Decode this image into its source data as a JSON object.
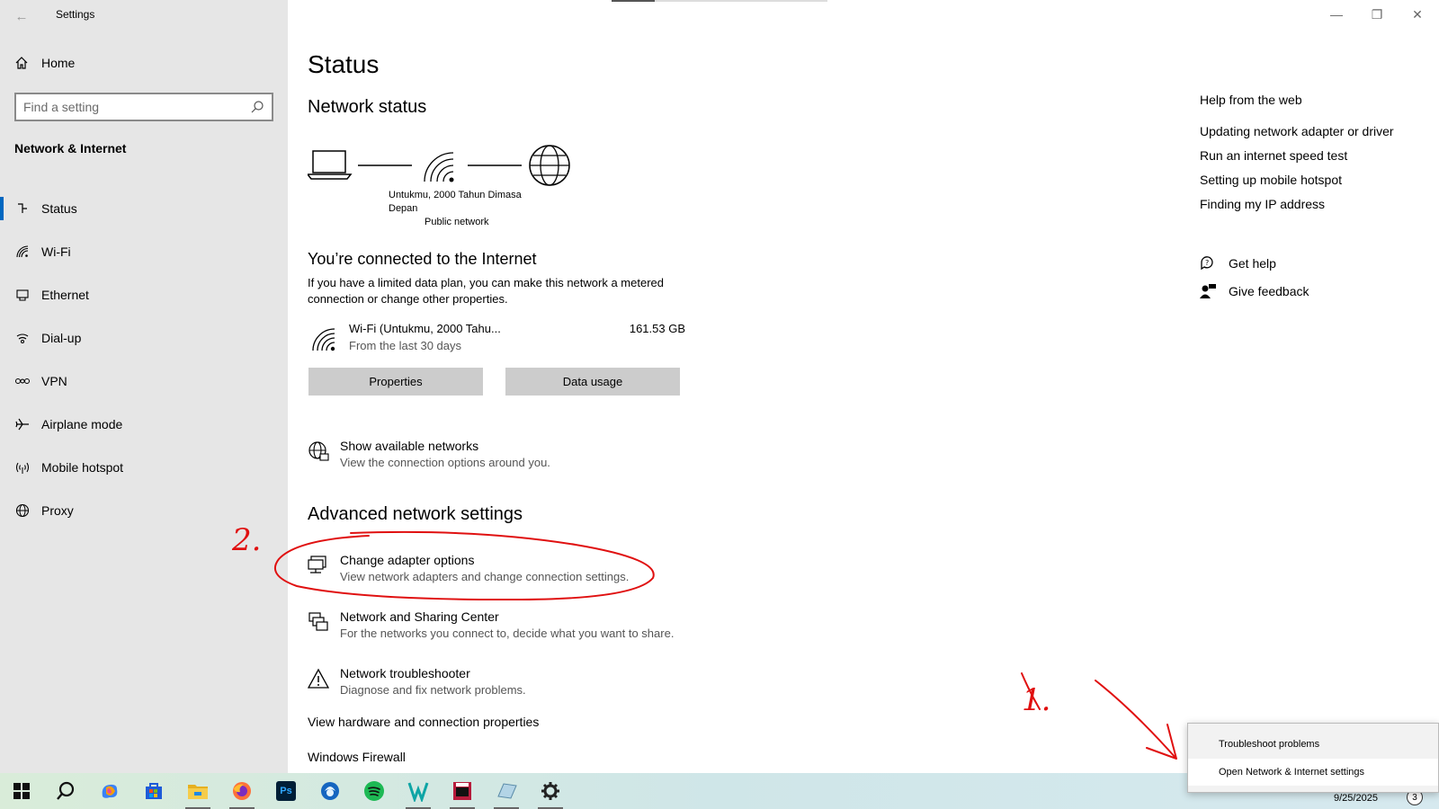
{
  "window": {
    "title": "Settings",
    "minimize_glyph": "—",
    "maximize_glyph": "❐",
    "close_glyph": "✕",
    "back_glyph": "←"
  },
  "sidebar": {
    "home_label": "Home",
    "search_placeholder": "Find a setting",
    "section_title": "Network & Internet",
    "items": [
      {
        "label": "Status",
        "icon": "status-icon",
        "active": true
      },
      {
        "label": "Wi-Fi",
        "icon": "wifi-icon"
      },
      {
        "label": "Ethernet",
        "icon": "ethernet-icon"
      },
      {
        "label": "Dial-up",
        "icon": "dialup-icon"
      },
      {
        "label": "VPN",
        "icon": "vpn-icon"
      },
      {
        "label": "Airplane mode",
        "icon": "airplane-icon"
      },
      {
        "label": "Mobile hotspot",
        "icon": "hotspot-icon"
      },
      {
        "label": "Proxy",
        "icon": "globe-icon"
      }
    ]
  },
  "main": {
    "title": "Status",
    "network_status_heading": "Network status",
    "diagram": {
      "network_name": "Untukmu, 2000 Tahun Dimasa Depan",
      "network_type": "Public network"
    },
    "connected": {
      "title": "You’re connected to the Internet",
      "description": "If you have a limited data plan, you can make this network a metered connection or change other properties."
    },
    "wifi_row": {
      "name": "Wi-Fi (Untukmu, 2000 Tahu...",
      "subtitle": "From the last 30 days",
      "usage": "161.53 GB"
    },
    "buttons": {
      "properties": "Properties",
      "data_usage": "Data usage"
    },
    "show_networks": {
      "title": "Show available networks",
      "description": "View the connection options around you."
    },
    "advanced_heading": "Advanced network settings",
    "advanced_items": [
      {
        "title": "Change adapter options",
        "description": "View network adapters and change connection settings."
      },
      {
        "title": "Network and Sharing Center",
        "description": "For the networks you connect to, decide what you want to share."
      },
      {
        "title": "Network troubleshooter",
        "description": "Diagnose and fix network problems."
      }
    ],
    "hardware_link": "View hardware and connection properties",
    "firewall_link": "Windows Firewall"
  },
  "help": {
    "title": "Help from the web",
    "links": [
      "Updating network adapter or driver",
      "Run an internet speed test",
      "Setting up mobile hotspot",
      "Finding my IP address"
    ],
    "get_help": "Get help",
    "give_feedback": "Give feedback"
  },
  "context_menu": {
    "items": [
      "Troubleshoot problems",
      "Open Network & Internet settings"
    ]
  },
  "taskbar": {
    "date": "9/25/2025",
    "notification_count": "3",
    "apps": [
      "windows-start-icon",
      "search-icon",
      "copilot-icon",
      "store-icon",
      "file-explorer-icon",
      "firefox-icon",
      "photoshop-icon",
      "app-icon",
      "spotify-icon",
      "app-icon",
      "app-icon",
      "app-icon",
      "settings-icon"
    ],
    "photoshop_label": "Ps"
  },
  "annotations": {
    "label_1": "1.",
    "label_2": "2.",
    "color": "#e01010"
  },
  "colors": {
    "sidebar_bg": "#e6e6e6",
    "accent": "#0067c0",
    "button_bg": "#cccccc"
  }
}
